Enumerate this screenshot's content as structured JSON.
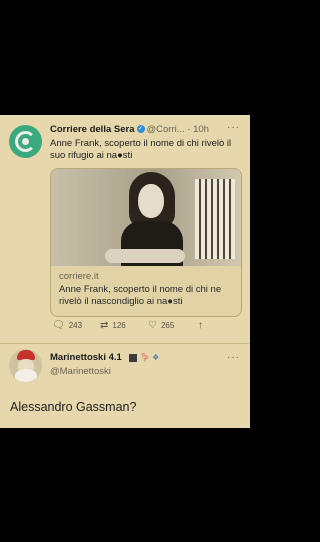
{
  "tweet": {
    "author_name": "Corriere della Sera",
    "handle": "@Corri...",
    "time": "· 10h",
    "more": "···",
    "text": "Anne Frank, scoperto il nome di chi rivelò il suo rifugio ai na●sti",
    "card": {
      "domain": "corriere.it",
      "title": "Anne Frank, scoperto il nome di chi ne rivelò il nascondiglio ai na●sti"
    },
    "actions": {
      "reply_count": "243",
      "retweet_count": "126",
      "like_count": "265"
    }
  },
  "reply": {
    "name": "Marinettoski",
    "version": "4.1",
    "handle": "@Marinettoski",
    "more": "···",
    "text": "Alessandro Gassman?"
  },
  "icons": [
    "verified-badge-icon",
    "reply-icon",
    "retweet-icon",
    "like-icon",
    "share-icon",
    "more-icon",
    "flamingo-icon",
    "puzzle-icon"
  ],
  "colors": {
    "background": "#e6d8ac",
    "brand_avatar": "#3aa97d",
    "verified": "#2a8ed8"
  }
}
